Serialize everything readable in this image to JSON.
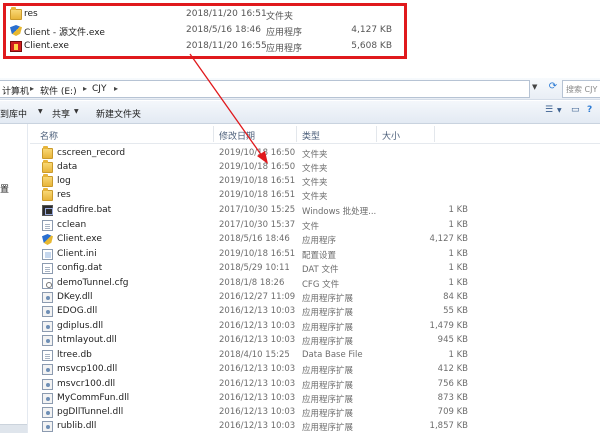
{
  "zoom_rows": [
    {
      "name": "res",
      "date": "2018/11/20 16:51",
      "type": "文件夹",
      "size": "",
      "icon": "folder-icon"
    },
    {
      "name": "Client - 源文件.exe",
      "date": "2018/5/16 18:46",
      "type": "应用程序",
      "size": "4,127 KB",
      "icon": "shield-exe-icon"
    },
    {
      "name": "Client.exe",
      "date": "2018/11/20 16:55",
      "type": "应用程序",
      "size": "5,608 KB",
      "icon": "red-exe-icon"
    }
  ],
  "address": {
    "crumbs": [
      "计算机",
      "软件 (E:)",
      "CJY"
    ],
    "search_placeholder": "搜索 CJY"
  },
  "toolbar": {
    "include_label": "到库中",
    "share_label": "共享",
    "new_folder_label": "新建文件夹"
  },
  "nav": {
    "item1": "置"
  },
  "columns": {
    "name": "名称",
    "date": "修改日期",
    "type": "类型",
    "size": "大小"
  },
  "files": [
    {
      "name": "cscreen_record",
      "date": "2019/10/18 16:50",
      "type": "文件夹",
      "size": "",
      "icon": "folder"
    },
    {
      "name": "data",
      "date": "2019/10/18 16:50",
      "type": "文件夹",
      "size": "",
      "icon": "folder"
    },
    {
      "name": "log",
      "date": "2019/10/18 16:51",
      "type": "文件夹",
      "size": "",
      "icon": "folder"
    },
    {
      "name": "res",
      "date": "2019/10/18 16:51",
      "type": "文件夹",
      "size": "",
      "icon": "folder"
    },
    {
      "name": "caddfire.bat",
      "date": "2017/10/30 15:25",
      "type": "Windows 批处理...",
      "size": "1 KB",
      "icon": "bat"
    },
    {
      "name": "cclean",
      "date": "2017/10/30 15:37",
      "type": "文件",
      "size": "1 KB",
      "icon": "doc"
    },
    {
      "name": "Client.exe",
      "date": "2018/5/16 18:46",
      "type": "应用程序",
      "size": "4,127 KB",
      "icon": "shield"
    },
    {
      "name": "Client.ini",
      "date": "2019/10/18 16:51",
      "type": "配置设置",
      "size": "1 KB",
      "icon": "ini"
    },
    {
      "name": "config.dat",
      "date": "2018/5/29 10:11",
      "type": "DAT 文件",
      "size": "1 KB",
      "icon": "doc"
    },
    {
      "name": "demoTunnel.cfg",
      "date": "2018/1/8 18:26",
      "type": "CFG 文件",
      "size": "1 KB",
      "icon": "cfg"
    },
    {
      "name": "DKey.dll",
      "date": "2016/12/27 11:09",
      "type": "应用程序扩展",
      "size": "84 KB",
      "icon": "dll"
    },
    {
      "name": "EDOG.dll",
      "date": "2016/12/13 10:03",
      "type": "应用程序扩展",
      "size": "55 KB",
      "icon": "dll"
    },
    {
      "name": "gdiplus.dll",
      "date": "2016/12/13 10:03",
      "type": "应用程序扩展",
      "size": "1,479 KB",
      "icon": "dll"
    },
    {
      "name": "htmlayout.dll",
      "date": "2016/12/13 10:03",
      "type": "应用程序扩展",
      "size": "945 KB",
      "icon": "dll"
    },
    {
      "name": "ltree.db",
      "date": "2018/4/10 15:25",
      "type": "Data Base File",
      "size": "1 KB",
      "icon": "doc"
    },
    {
      "name": "msvcp100.dll",
      "date": "2016/12/13 10:03",
      "type": "应用程序扩展",
      "size": "412 KB",
      "icon": "dll"
    },
    {
      "name": "msvcr100.dll",
      "date": "2016/12/13 10:03",
      "type": "应用程序扩展",
      "size": "756 KB",
      "icon": "dll"
    },
    {
      "name": "MyCommFun.dll",
      "date": "2016/12/13 10:03",
      "type": "应用程序扩展",
      "size": "873 KB",
      "icon": "dll"
    },
    {
      "name": "pgDllTunnel.dll",
      "date": "2016/12/13 10:03",
      "type": "应用程序扩展",
      "size": "709 KB",
      "icon": "dll"
    },
    {
      "name": "rublib.dll",
      "date": "2016/12/13 10:03",
      "type": "应用程序扩展",
      "size": "1,857 KB",
      "icon": "dll"
    }
  ],
  "colors": {
    "highlight_border": "#e0191c",
    "arrow": "#e0191c"
  }
}
